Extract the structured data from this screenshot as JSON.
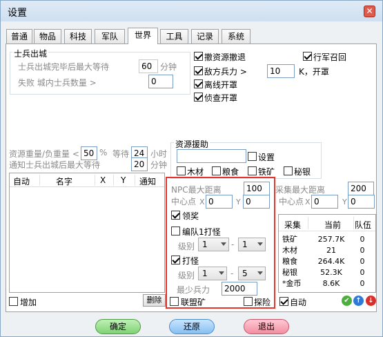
{
  "window": {
    "title": "设置",
    "close_glyph": "✕"
  },
  "tabs": [
    "普通",
    "物品",
    "科技",
    "军队",
    "世界",
    "工具",
    "记录",
    "系统"
  ],
  "soldier_out": {
    "group_title": "士兵出城",
    "max_wait_label": "士兵出城完毕后最大等待",
    "max_wait_value": "60",
    "max_wait_unit": "分钟",
    "fail_label": "失败 城内士兵数量 >",
    "fail_value": "0"
  },
  "right_options": {
    "grab_retreat": "撤资源撤退",
    "enemy_force": "敌方兵力 >",
    "enemy_force_value": "10",
    "enemy_force_unit": "K，开罩",
    "offline_shield": "离线开罩",
    "scout_shield": "侦查开罩",
    "recall": "行军召回"
  },
  "resource_weight": {
    "label": "资源重量/负重量 <",
    "value": "50",
    "unit": "%",
    "wait_label": "等待",
    "wait_value": "24",
    "wait_unit": "小时"
  },
  "notify_wait": {
    "label": "通知士兵出城后最大等待",
    "value": "20",
    "unit": "分钟"
  },
  "resource_aid": {
    "group_title": "资源援助",
    "input_value": "",
    "settings_label": "设置",
    "wood": "木材",
    "food": "粮食",
    "iron": "铁矿",
    "silver": "秘银"
  },
  "task_list": {
    "columns": [
      "自动",
      "名字",
      "X",
      "Y",
      "通知"
    ],
    "add_label": "增加",
    "delete_label": "删除"
  },
  "npc": {
    "max_distance_label": "NPC最大距离",
    "max_distance_value": "100",
    "center_label": "中心点",
    "x_label": "X",
    "x_value": "0",
    "y_label": "Y",
    "y_value": "0",
    "reward_label": "领奖",
    "team_monster_label": "编队1打怪",
    "level_label": "级别",
    "team_level_from": "1",
    "team_level_sep": "-",
    "team_level_to": "1",
    "monster_label": "打怪",
    "monster_level_from": "1",
    "monster_level_to": "5",
    "min_force_label": "最少兵力",
    "min_force_value": "2000",
    "alliance_mine_label": "联盟矿",
    "explore_label": "探险"
  },
  "gather": {
    "max_distance_label": "采集最大距离",
    "max_distance_value": "200",
    "center_label": "中心点",
    "x_label": "X",
    "x_value": "0",
    "y_label": "Y",
    "y_value": "0",
    "columns": [
      "采集",
      "当前",
      "队伍"
    ],
    "rows": [
      {
        "name": "铁矿",
        "current": "257.7K",
        "team": "0"
      },
      {
        "name": "木材",
        "current": "21",
        "team": "0"
      },
      {
        "name": "粮食",
        "current": "264.4K",
        "team": "0"
      },
      {
        "name": "秘银",
        "current": "52.3K",
        "team": "0"
      },
      {
        "name": "*金币",
        "current": "8.6K",
        "team": "0"
      }
    ],
    "auto_label": "自动",
    "icons": {
      "ok": "✔",
      "up": "↑",
      "down": "↓"
    }
  },
  "footer": {
    "ok": "确定",
    "restore": "还原",
    "exit": "退出"
  }
}
